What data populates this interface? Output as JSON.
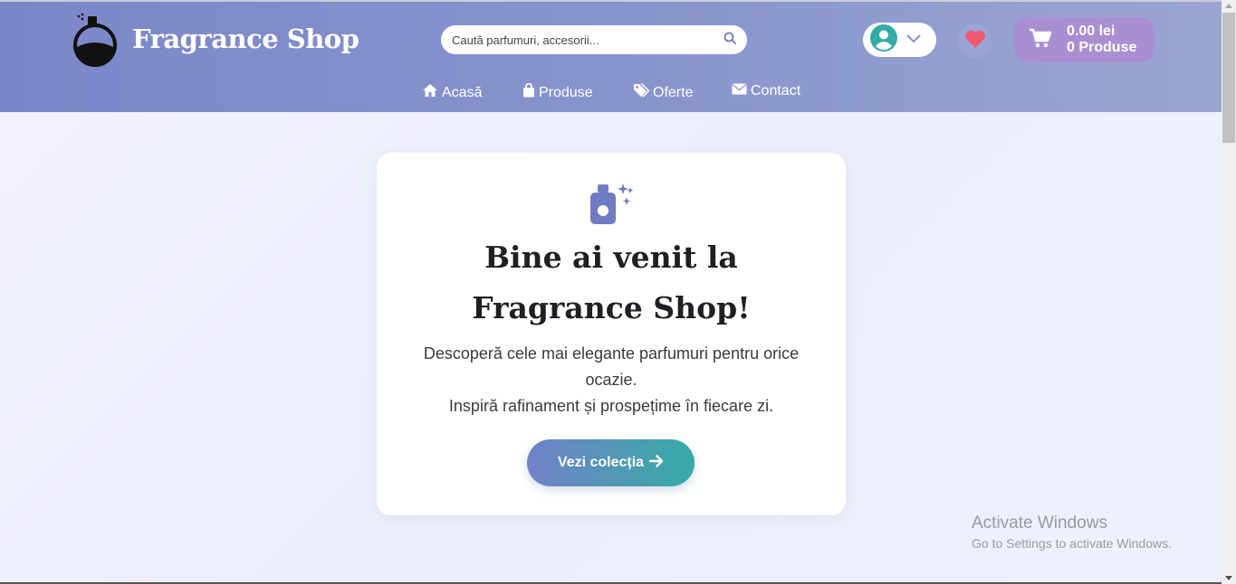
{
  "header": {
    "logo_text": "Fragrance Shop",
    "logo_icon": "perfume-bottle-icon",
    "search": {
      "placeholder": "Caută parfumuri, accesorii...",
      "icon": "search-icon"
    },
    "account": {
      "icon": "user-circle-icon",
      "chevron": "chevron-down-icon"
    },
    "wishlist": {
      "icon": "heart-icon"
    },
    "cart": {
      "icon": "cart-icon",
      "total": "0.00 lei",
      "count": "0 Produse"
    },
    "nav": [
      {
        "label": "Acasă",
        "icon": "home-icon"
      },
      {
        "label": "Produse",
        "icon": "shopping-bag-icon"
      },
      {
        "label": "Oferte",
        "icon": "tags-icon"
      },
      {
        "label": "Contact",
        "icon": "envelope-icon"
      }
    ]
  },
  "hero": {
    "icon": "spray-bottle-sparkle-icon",
    "title": "Bine ai venit la Fragrance Shop!",
    "description_line1": "Descoperă cele mai elegante parfumuri pentru orice ocazie.",
    "description_line2": "Inspiră rafinament și prospețime în fiecare zi.",
    "cta_label": "Vezi colecția",
    "cta_icon": "arrow-right-icon"
  },
  "watermark": {
    "title": "Activate Windows",
    "subtitle": "Go to Settings to activate Windows."
  },
  "colors": {
    "header_gradient_start": "#7a86c8",
    "header_gradient_end": "#9aa6d0",
    "accent_teal": "#35aba5",
    "accent_indigo": "#7281c8",
    "cart_bg": "#a98fd2",
    "heart": "#ef5a6f"
  }
}
